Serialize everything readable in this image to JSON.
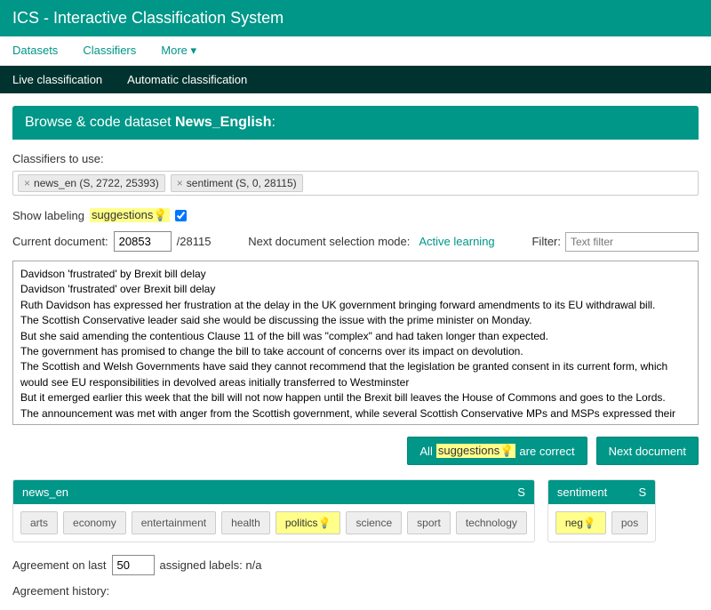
{
  "header": {
    "title": "ICS - Interactive Classification System"
  },
  "nav": {
    "datasets": "Datasets",
    "classifiers": "Classifiers",
    "more": "More ▾"
  },
  "subnav": {
    "live": "Live classification",
    "auto": "Automatic classification"
  },
  "panel": {
    "title_prefix": "Browse & code dataset ",
    "dataset_name": "News_English",
    "classifiers_label": "Classifiers to use:",
    "classifiers": {
      "c1": "news_en (S, 2722, 25393)",
      "c2": "sentiment (S, 0, 28115)"
    },
    "show_labeling_prefix": "Show labeling ",
    "show_labeling_highlight": "suggestions",
    "suggestions_checked": true,
    "current_doc_label": "Current document:",
    "current_doc_value": "20853",
    "current_doc_total": "/28115",
    "next_mode_label": "Next document selection mode:",
    "next_mode_value": "Active learning",
    "filter_label": "Filter:",
    "filter_placeholder": "Text filter",
    "doc_text": "Davidson 'frustrated' by Brexit bill delay\nDavidson 'frustrated' over Brexit bill delay\nRuth Davidson has expressed her frustration at the delay in the UK government bringing forward amendments to its EU withdrawal bill.\nThe Scottish Conservative leader said she would be discussing the issue with the prime minister on Monday.\nBut she said amending the contentious Clause 11 of the bill was \"complex\" and had taken longer than expected.\nThe government has promised to change the bill to take account of concerns over its impact on devolution.\nThe Scottish and Welsh Governments have said they cannot recommend that the legislation be granted consent in its current form, which would see EU responsibilities in devolved areas initially transferred to Westminster\nBut it emerged earlier this week that the bill will not now happen until the Brexit bill leaves the House of Commons and goes to the Lords.\nThe announcement was met with anger from the Scottish government, while several Scottish Conservative MPs and MSPs expressed their surprise and disappointment.\n, Ms Davidson said she shared that frustration, and that she wished an agreement over the changes to the Brexit bill had already been \"nailed down\".",
    "all_correct_prefix": "All ",
    "all_correct_highlight": "suggestions",
    "all_correct_suffix": " are correct",
    "next_doc_btn": "Next document",
    "groups": {
      "news": {
        "name": "news_en",
        "badge": "S",
        "cats": {
          "arts": "arts",
          "economy": "economy",
          "entertainment": "entertainment",
          "health": "health",
          "politics": "politics",
          "science": "science",
          "sport": "sport",
          "technology": "technology"
        }
      },
      "sentiment": {
        "name": "sentiment",
        "badge": "S",
        "cats": {
          "neg": "neg",
          "pos": "pos"
        }
      }
    },
    "agreement_prefix": "Agreement on last ",
    "agreement_value": "50",
    "agreement_suffix": " assigned labels: n/a",
    "agreement_history": "Agreement history:"
  }
}
